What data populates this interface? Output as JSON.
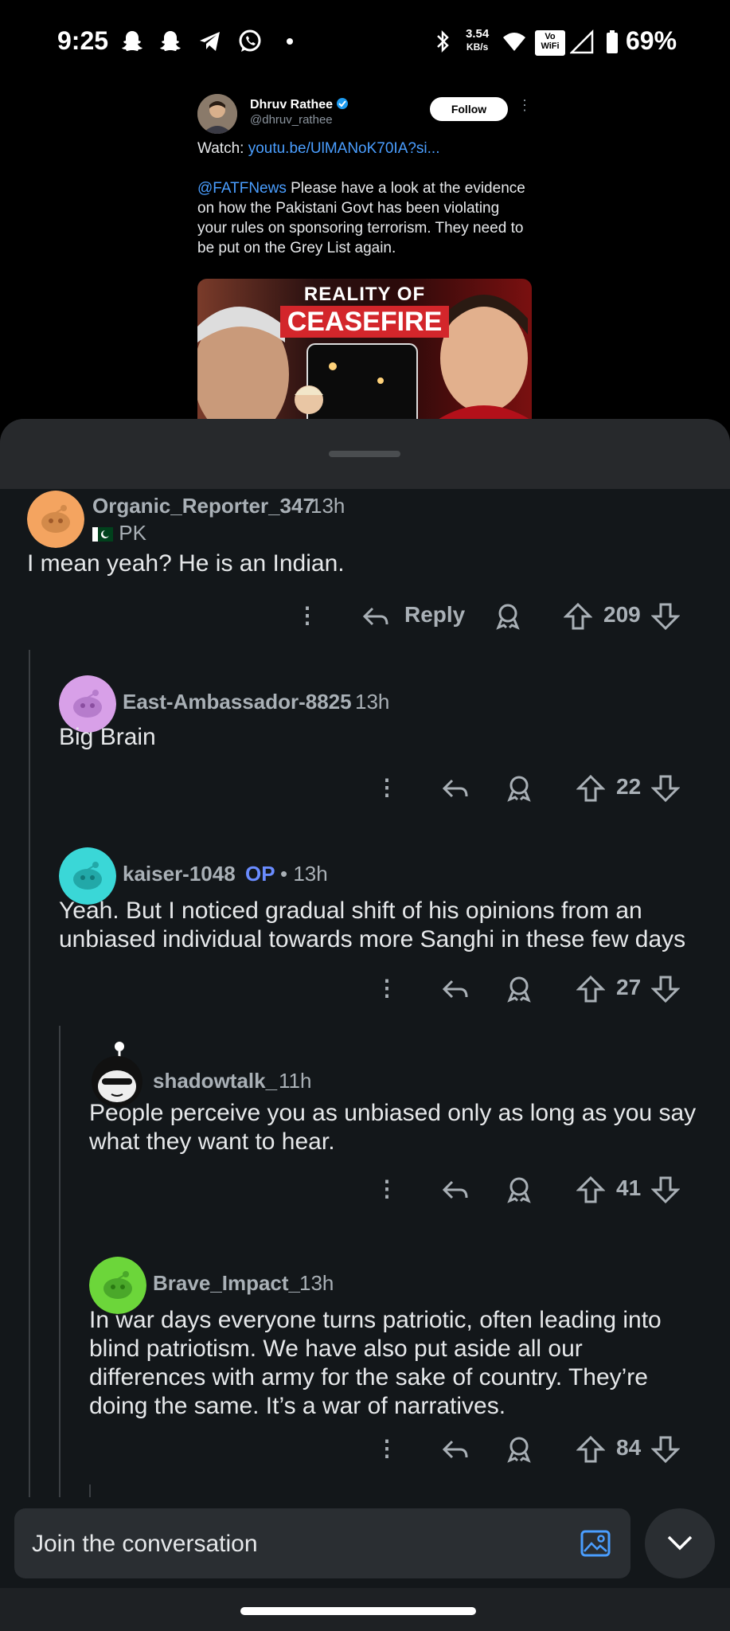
{
  "status_bar": {
    "time": "9:25",
    "speed_value": "3.54",
    "speed_unit": "KB/s",
    "vowifi_top": "Vo",
    "vowifi_bottom": "WiFi",
    "battery": "69%",
    "notification_icons": [
      "snapchat-icon",
      "snapchat-icon",
      "telegram-icon",
      "whatsapp-icon",
      "dot-icon"
    ]
  },
  "tweet": {
    "author_name": "Dhruv Rathee",
    "handle": "@dhruv_rathee",
    "follow_label": "Follow",
    "watch_prefix": "Watch: ",
    "watch_link": "youtu.be/UlMANoK70IA?si...",
    "mention": "@FATFNews",
    "body": " Please have a look at the evidence on how the Pakistani Govt has been violating your rules on sponsoring terrorism. They need to be put on the Grey List again.",
    "thumb_title_1": "REALITY OF",
    "thumb_title_2": "CEASEFIRE"
  },
  "comments": [
    {
      "username": "Organic_Reporter_347",
      "time": "13h",
      "flair": "PK",
      "text": "I mean yeah? He is an Indian.",
      "reply_label": "Reply",
      "votes": "209",
      "avatar_color": "#f4a460"
    },
    {
      "username": "East-Ambassador-8825",
      "time": "13h",
      "text": "Big Brain",
      "votes": "22",
      "avatar_color": "#d8a0e8"
    },
    {
      "username": "kaiser-1048",
      "op_label": "OP",
      "time": "• 13h",
      "text_line1": "Yeah. But I noticed gradual shift of his opinions from an",
      "text_line2": "unbiased individual towards more Sanghi in these few days",
      "votes": "27",
      "avatar_color": "#3ad7d7"
    },
    {
      "username": "shadowtalk_",
      "time": "11h",
      "text_line1": "People perceive you as unbiased only as long as you say",
      "text_line2": "what they want to hear.",
      "votes": "41",
      "avatar_color": "#ffffff"
    },
    {
      "username": "Brave_Impact_",
      "time": "13h",
      "text_line1": "In war days everyone turns patriotic, often leading into",
      "text_line2": "blind patriotism. We have also put aside all our",
      "text_line3": "differences with army for the sake of country. They’re",
      "text_line4": "doing the same. It’s a war of narratives.",
      "votes": "84",
      "avatar_color": "#6cd63a"
    }
  ],
  "composer": {
    "placeholder": "Join the conversation"
  },
  "colors": {
    "accent_link": "#4a9eff",
    "op_badge": "#6a8cff",
    "sheet_bg": "#13171a"
  }
}
